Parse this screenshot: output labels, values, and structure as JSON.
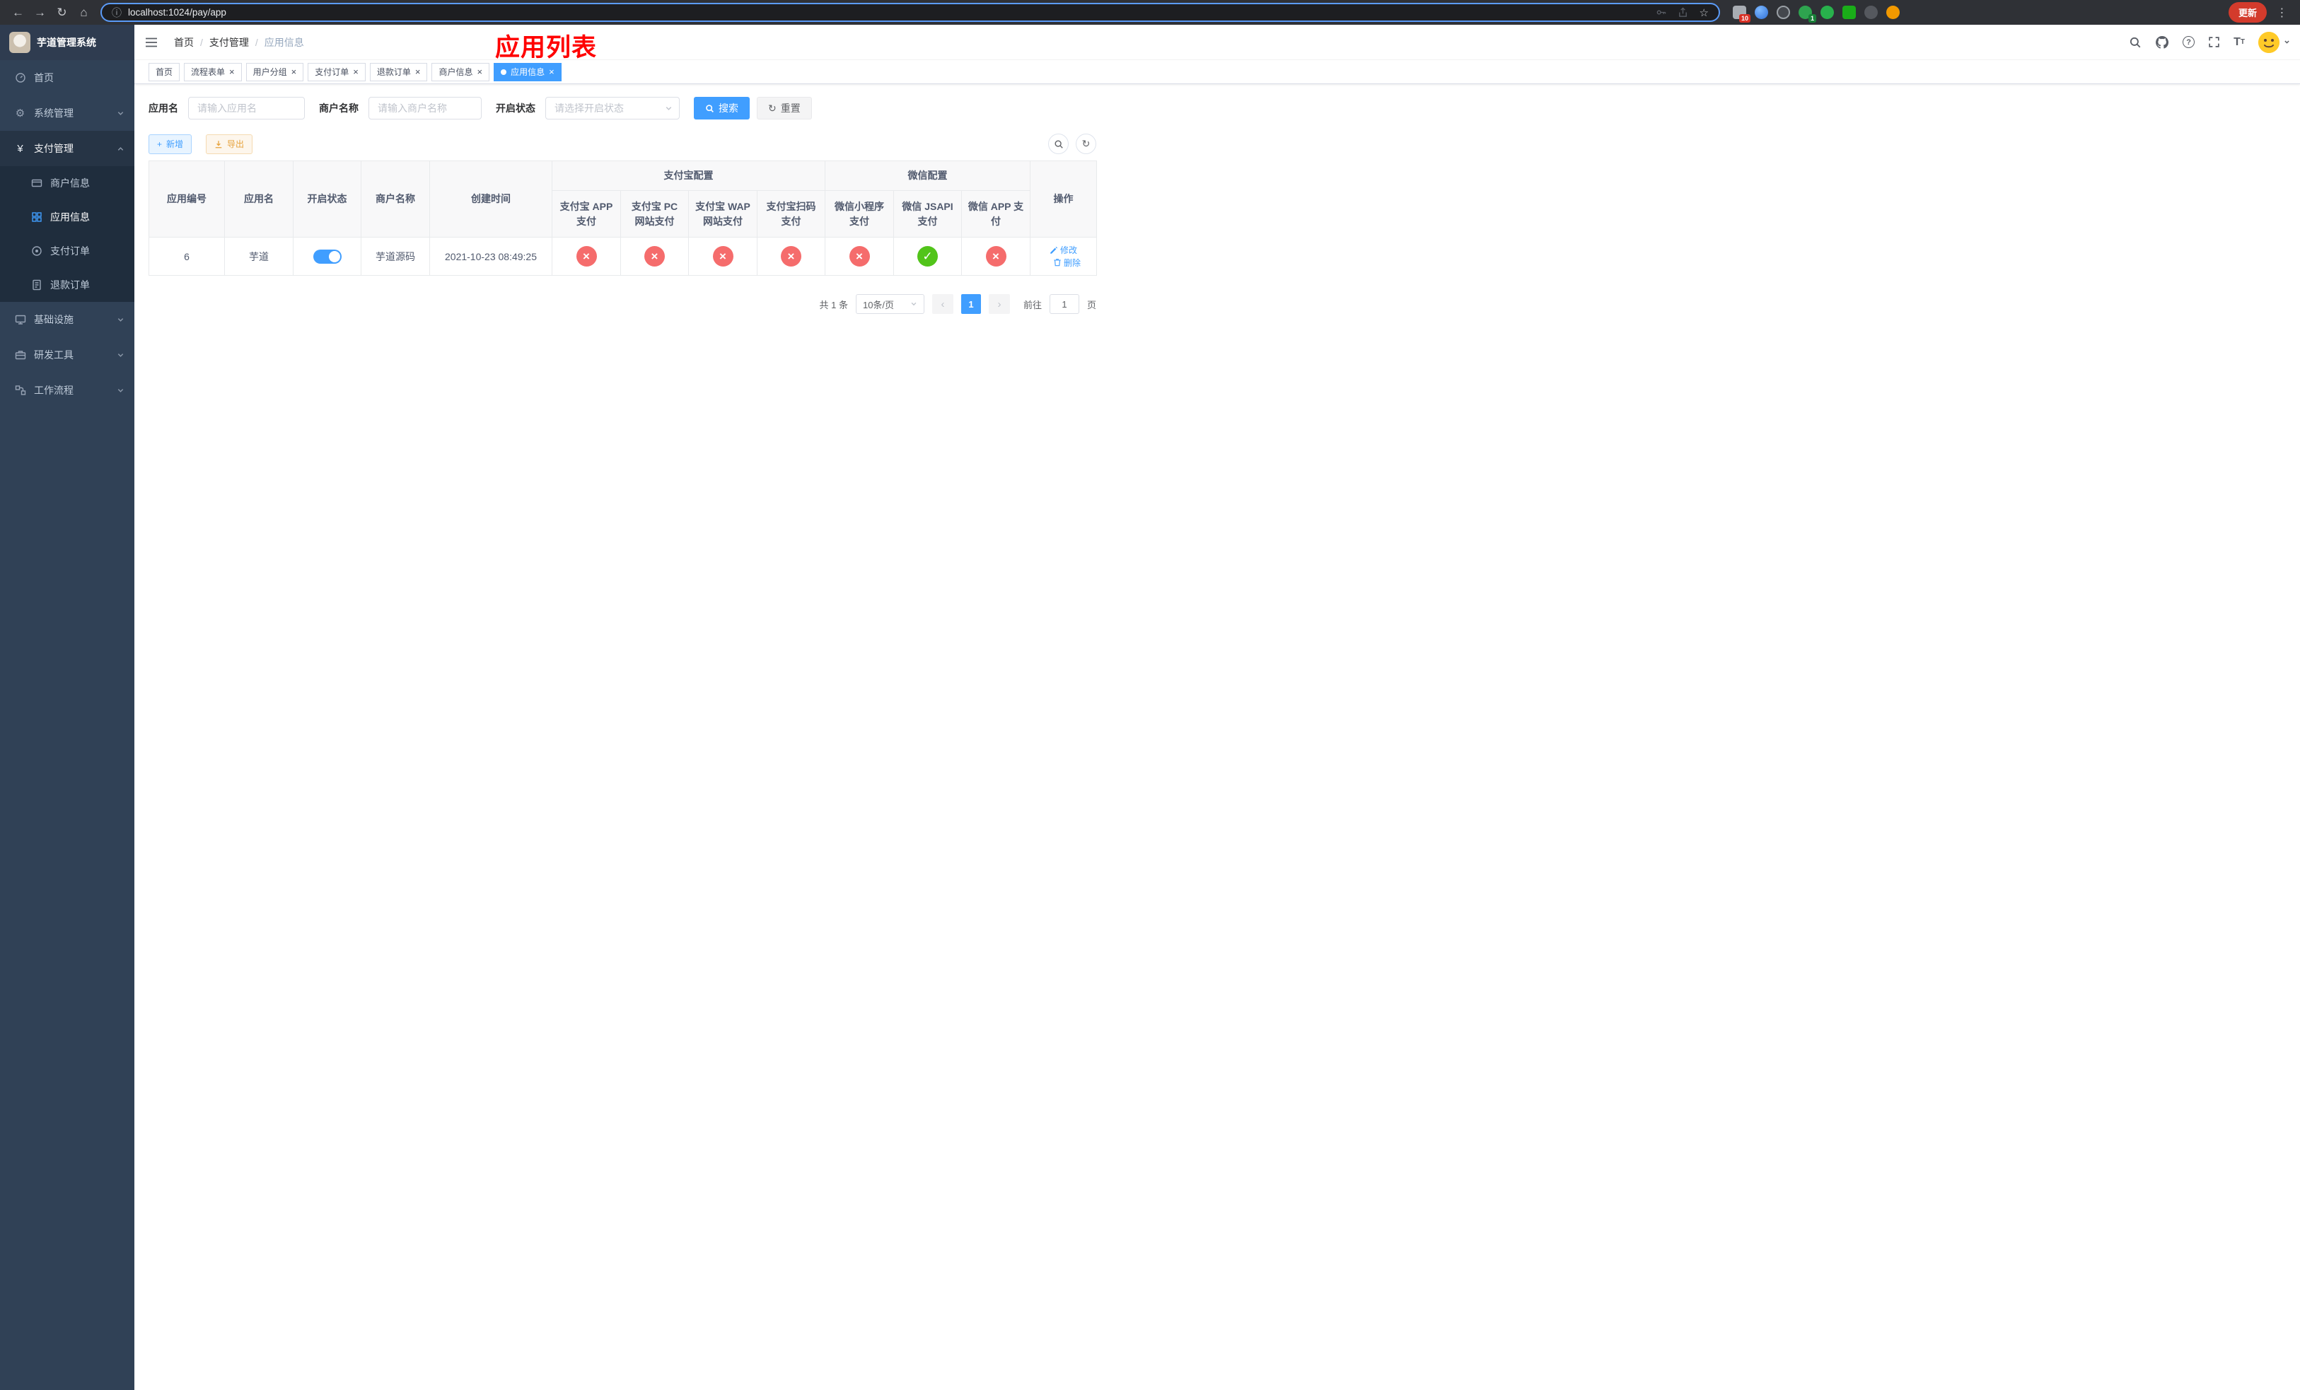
{
  "browser": {
    "url": "localhost:1024/pay/app",
    "update_button": "更新",
    "extensions": {
      "badge_a": "10",
      "badge_b": "1"
    }
  },
  "icons": {
    "back": "←",
    "forward": "→",
    "reload": "↻",
    "home": "⌂",
    "info": "ⓘ",
    "star": "☆",
    "kebab": "⋮",
    "gear": "⚙",
    "yen": "¥",
    "help": "?",
    "plus": "+",
    "refresh": "↻",
    "close": "×",
    "prev": "‹",
    "next": "›",
    "font_big": "T",
    "font_small": "T",
    "status_no": "×",
    "status_yes": "✓"
  },
  "sidebar": {
    "title": "芋道管理系统",
    "items": {
      "home": "首页",
      "system": "系统管理",
      "payment": "支付管理",
      "merchant_info": "商户信息",
      "app_info": "应用信息",
      "pay_order": "支付订单",
      "refund_order": "退款订单",
      "infrastructure": "基础设施",
      "dev_tools": "研发工具",
      "workflow": "工作流程"
    }
  },
  "navbar": {
    "breadcrumb": [
      "首页",
      "支付管理",
      "应用信息"
    ],
    "separator": "/",
    "page_overlay_title": "应用列表"
  },
  "tabs": [
    {
      "label": "首页"
    },
    {
      "label": "流程表单"
    },
    {
      "label": "用户分组"
    },
    {
      "label": "支付订单"
    },
    {
      "label": "退款订单"
    },
    {
      "label": "商户信息"
    },
    {
      "label": "应用信息"
    }
  ],
  "filters": {
    "app_name_label": "应用名",
    "app_name_placeholder": "请输入应用名",
    "merchant_name_label": "商户名称",
    "merchant_name_placeholder": "请输入商户名称",
    "status_label": "开启状态",
    "status_placeholder": "请选择开启状态",
    "search_button": "搜索",
    "reset_button": "重置"
  },
  "toolbar": {
    "add_button": "新增",
    "export_button": "导出"
  },
  "table": {
    "group_headers": {
      "alipay": "支付宝配置",
      "wechat": "微信配置"
    },
    "columns": [
      "应用编号",
      "应用名",
      "开启状态",
      "商户名称",
      "创建时间",
      "支付宝 APP 支付",
      "支付宝 PC 网站支付",
      "支付宝 WAP 网站支付",
      "支付宝扫码支付",
      "微信小程序支付",
      "微信 JSAPI 支付",
      "微信 APP 支付",
      "操作"
    ],
    "rows": [
      {
        "app_id": "6",
        "app_name": "芋道",
        "status_on": true,
        "merchant_name": "芋道源码",
        "created_at": "2021-10-23 08:49:25",
        "alipay_app": "disabled",
        "alipay_pc": "disabled",
        "alipay_wap": "disabled",
        "alipay_qr": "disabled",
        "wx_mini": "disabled",
        "wx_jsapi": "enabled",
        "wx_app": "disabled",
        "edit_label": "修改",
        "delete_label": "删除"
      }
    ]
  },
  "pagination": {
    "total_text": "共 1 条",
    "page_size": "10条/页",
    "current_page": "1",
    "goto_label": "前往",
    "goto_value": "1",
    "page_suffix": "页"
  },
  "colors": {
    "primary": "#409eff",
    "danger": "#f56c6c",
    "success": "#52c41a",
    "warning": "#e6a23c",
    "annotation_red": "#ff0000",
    "sidebar_bg": "#304156",
    "submenu_bg": "#1f2d3d"
  }
}
